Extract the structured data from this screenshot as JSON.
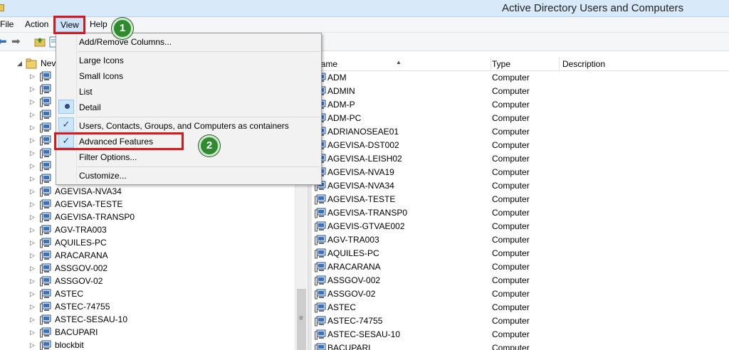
{
  "window": {
    "title": "Active Directory Users and Computers"
  },
  "menubar": {
    "items": [
      "File",
      "Action",
      "View",
      "Help"
    ]
  },
  "view_menu": {
    "items": [
      {
        "label": "Add/Remove Columns..."
      },
      {
        "label": "Large Icons"
      },
      {
        "label": "Small Icons"
      },
      {
        "label": "List"
      },
      {
        "label": "Detail"
      },
      {
        "label": "Users, Contacts, Groups, and Computers as containers"
      },
      {
        "label": "Advanced Features"
      },
      {
        "label": "Filter Options..."
      },
      {
        "label": "Customize..."
      }
    ]
  },
  "callouts": {
    "step1": "1",
    "step2": "2"
  },
  "tree": {
    "root_label": "Nev",
    "items": [
      "AGEVISA-NVA34",
      "AGEVISA-TESTE",
      "AGEVISA-TRANSP0",
      "AGV-TRA003",
      "AQUILES-PC",
      "ARACARANA",
      "ASSGOV-002",
      "ASSGOV-02",
      "ASTEC",
      "ASTEC-74755",
      "ASTEC-SESAU-10",
      "BACUPARI",
      "blockbit"
    ]
  },
  "list": {
    "columns": [
      "Name",
      "Type",
      "Description"
    ],
    "rows": [
      {
        "name": "ADM",
        "type": "Computer"
      },
      {
        "name": "ADMIN",
        "type": "Computer"
      },
      {
        "name": "ADM-P",
        "type": "Computer"
      },
      {
        "name": "ADM-PC",
        "type": "Computer"
      },
      {
        "name": "ADRIANOSEAE01",
        "type": "Computer"
      },
      {
        "name": "AGEVISA-DST002",
        "type": "Computer"
      },
      {
        "name": "AGEVISA-LEISH02",
        "type": "Computer"
      },
      {
        "name": "AGEVISA-NVA19",
        "type": "Computer"
      },
      {
        "name": "AGEVISA-NVA34",
        "type": "Computer"
      },
      {
        "name": "AGEVISA-TESTE",
        "type": "Computer"
      },
      {
        "name": "AGEVISA-TRANSP0",
        "type": "Computer"
      },
      {
        "name": "AGEVIS-GTVAE002",
        "type": "Computer"
      },
      {
        "name": "AGV-TRA003",
        "type": "Computer"
      },
      {
        "name": "AQUILES-PC",
        "type": "Computer"
      },
      {
        "name": "ARACARANA",
        "type": "Computer"
      },
      {
        "name": "ASSGOV-002",
        "type": "Computer"
      },
      {
        "name": "ASSGOV-02",
        "type": "Computer"
      },
      {
        "name": "ASTEC",
        "type": "Computer"
      },
      {
        "name": "ASTEC-74755",
        "type": "Computer"
      },
      {
        "name": "ASTEC-SESAU-10",
        "type": "Computer"
      },
      {
        "name": "BACUPARI",
        "type": "Computer"
      }
    ]
  },
  "icons": {
    "computer": "computer-icon",
    "folder": "folder-icon",
    "back": "back-arrow-icon",
    "forward": "forward-arrow-icon",
    "expand": "expand-triangle-icon",
    "check": "check-icon",
    "radio": "radio-dot-icon"
  },
  "colors": {
    "title_bar": "#d8eaf9",
    "highlight": "#d7191d",
    "badge": "#2e8b2e",
    "menu_selected": "#cce4f7"
  }
}
